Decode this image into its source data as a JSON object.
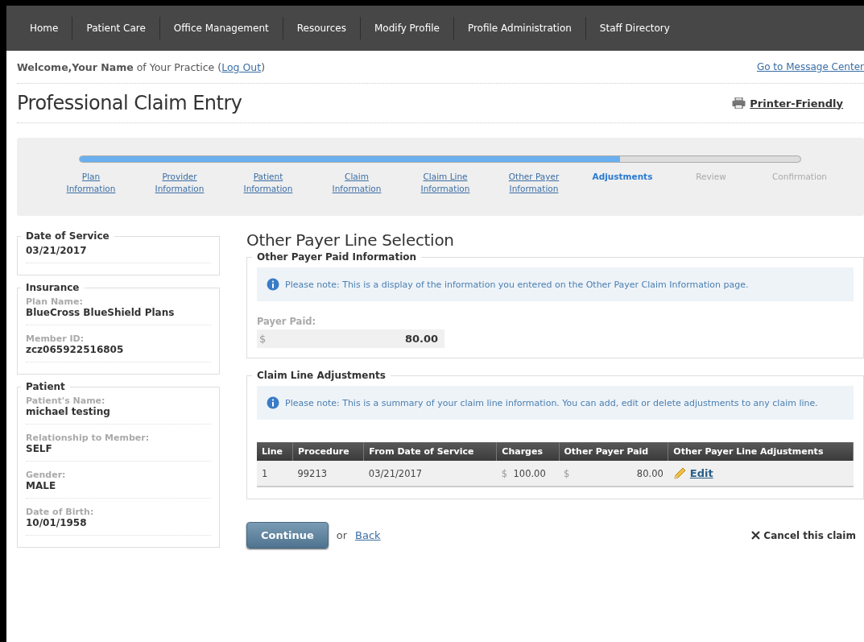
{
  "nav": [
    {
      "label": "Home"
    },
    {
      "label": "Patient Care"
    },
    {
      "label": "Office Management"
    },
    {
      "label": "Resources"
    },
    {
      "label": "Modify Profile"
    },
    {
      "label": "Profile Administration"
    },
    {
      "label": "Staff Directory"
    }
  ],
  "welcome": {
    "greeting": "Welcome,",
    "name": "Your Name",
    "practice": "of Your Practice",
    "logout_open": "(",
    "logout": "Log Out",
    "logout_close": ")",
    "message_center": "Go to Message Center"
  },
  "page_title": "Professional Claim Entry",
  "printer_friendly": "Printer-Friendly",
  "progress": {
    "level": 0.75
  },
  "steps": [
    {
      "label": "Plan Information",
      "selected": false,
      "disabled": false
    },
    {
      "label": "Provider Information",
      "selected": false,
      "disabled": false
    },
    {
      "label": "Patient Information",
      "selected": false,
      "disabled": false
    },
    {
      "label": "Claim Information",
      "selected": false,
      "disabled": false
    },
    {
      "label": "Claim Line Information",
      "selected": false,
      "disabled": false
    },
    {
      "label": "Other Payer Information",
      "selected": false,
      "disabled": false
    },
    {
      "label": "Adjustments",
      "selected": true,
      "disabled": false
    },
    {
      "label": "Review",
      "selected": false,
      "disabled": true
    },
    {
      "label": "Confirmation",
      "selected": false,
      "disabled": true
    }
  ],
  "sidebar": [
    {
      "title": "Date of Service",
      "fields": [
        {
          "value": "03/21/2017"
        }
      ]
    },
    {
      "title": "Insurance",
      "fields": [
        {
          "label": "Plan Name:",
          "value": "BlueCross BlueShield Plans"
        },
        {
          "label": "Member ID:",
          "value": "zcz065922516805"
        }
      ]
    },
    {
      "title": "Patient",
      "fields": [
        {
          "label": "Patient's Name:",
          "value": "michael testing"
        },
        {
          "label": "Relationship to Member:",
          "value": "SELF"
        },
        {
          "label": "Gender:",
          "value": "MALE"
        },
        {
          "label": "Date of Birth:",
          "value": "10/01/1958"
        }
      ]
    }
  ],
  "section_title": "Other Payer Line Selection",
  "paid_info": {
    "title": "Other Payer Paid Information",
    "note": "Please note: This is a display of the information you entered on the Other Payer Claim Information page.",
    "field_label": "Payer Paid:",
    "currency": "$",
    "value": "80.00"
  },
  "adjustments": {
    "title": "Claim Line Adjustments",
    "note": "Please note: This is a summary of your claim line information. You can add, edit or delete adjustments to any claim line.",
    "columns": [
      "Line",
      "Procedure",
      "From Date of Service",
      "Charges",
      "Other Payer Paid",
      "Other Payer Line Adjustments"
    ],
    "rows": [
      {
        "line": "1",
        "procedure": "99213",
        "date": "03/21/2017",
        "charges_currency": "$",
        "charges": "100.00",
        "paid_currency": "$",
        "paid": "80.00",
        "action": "Edit"
      }
    ]
  },
  "actions": {
    "continue": "Continue",
    "or": "or",
    "back": "Back",
    "cancel": "Cancel this claim"
  }
}
